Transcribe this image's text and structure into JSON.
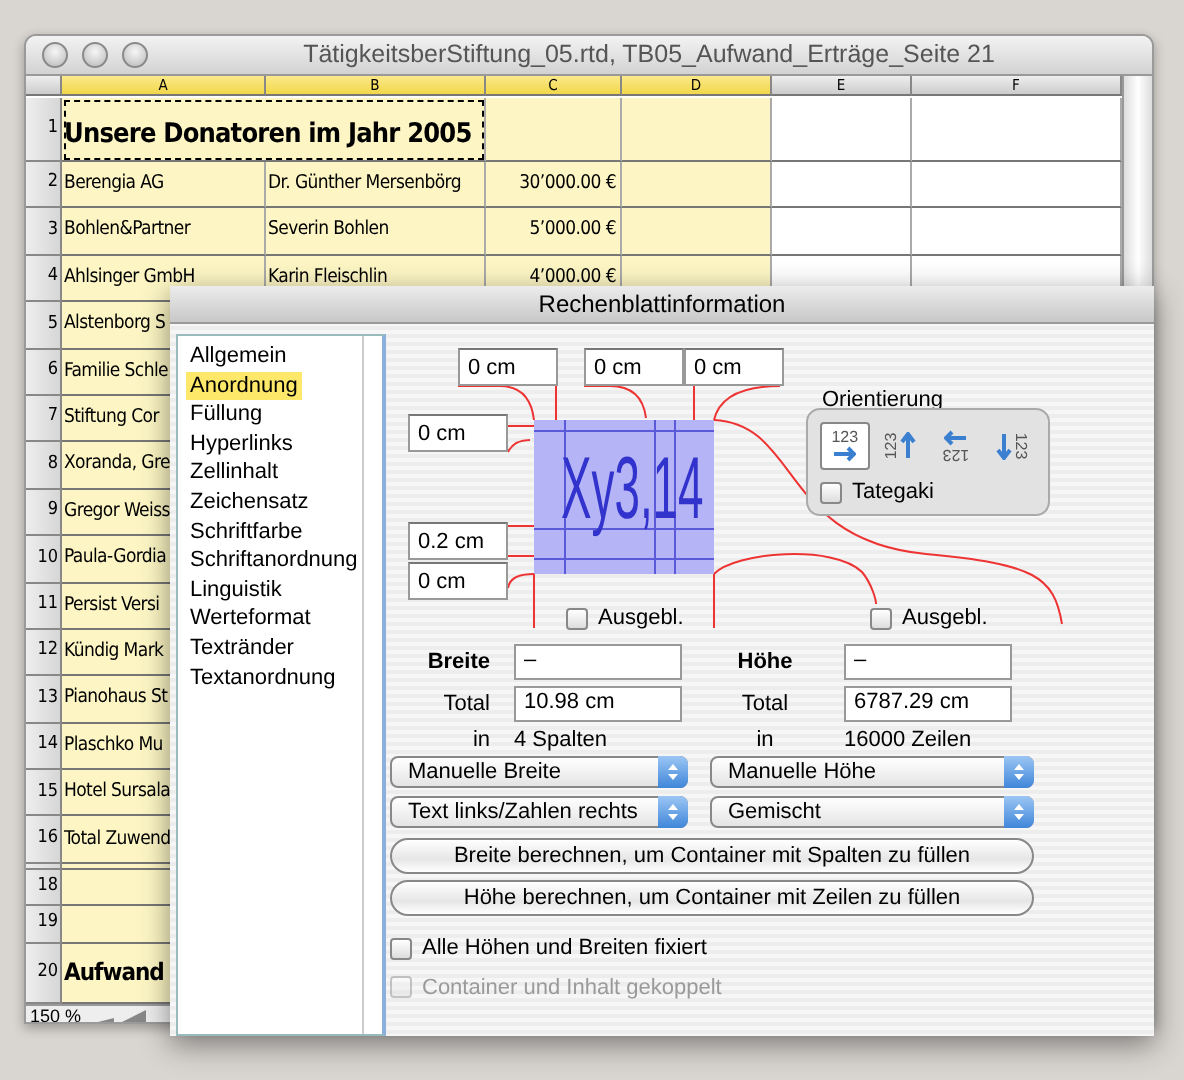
{
  "window": {
    "title": "TätigkeitsberStiftung_05.rtd, TB05_Aufwand_Erträge_Seite 21"
  },
  "spreadsheet": {
    "columns": [
      {
        "label": "A",
        "selected": true,
        "kind": "text"
      },
      {
        "label": "B",
        "selected": true,
        "kind": "text"
      },
      {
        "label": "C",
        "selected": true,
        "kind": "number"
      },
      {
        "label": "D",
        "selected": true,
        "kind": "text"
      },
      {
        "label": "E",
        "selected": false,
        "kind": "text"
      },
      {
        "label": "F",
        "selected": false,
        "kind": "text"
      }
    ],
    "rows": [
      {
        "number": "1",
        "kind": "title",
        "marked": true,
        "cells": [
          "Unsere Donatoren im Jahr 2005"
        ]
      },
      {
        "number": "2",
        "kind": "row",
        "cells": [
          "Berengia AG",
          "Dr. Günther Mersenbörg",
          "30’000.00 €"
        ]
      },
      {
        "number": "3",
        "kind": "row",
        "cells": [
          "Bohlen&Partner",
          "Severin Bohlen",
          "5’000.00 €"
        ]
      },
      {
        "number": "4",
        "kind": "row",
        "cells": [
          "Ahlsinger GmbH",
          "Karin Fleischlin",
          "4’000.00 €"
        ]
      },
      {
        "number": "5",
        "kind": "row",
        "cells": [
          "Alstenborg S"
        ]
      },
      {
        "number": "6",
        "kind": "row",
        "cells": [
          "Familie Schle"
        ]
      },
      {
        "number": "7",
        "kind": "row",
        "cells": [
          "Stiftung Cor"
        ]
      },
      {
        "number": "8",
        "kind": "row",
        "cells": [
          "Xoranda, Gre"
        ]
      },
      {
        "number": "9",
        "kind": "row",
        "cells": [
          "Gregor Weiss"
        ]
      },
      {
        "number": "10",
        "kind": "row",
        "cells": [
          "Paula-Gordia"
        ]
      },
      {
        "number": "11",
        "kind": "row",
        "cells": [
          "Persist Versi"
        ]
      },
      {
        "number": "12",
        "kind": "row",
        "cells": [
          "Kündig Mark"
        ]
      },
      {
        "number": "13",
        "kind": "row",
        "cells": [
          "Pianohaus St"
        ]
      },
      {
        "number": "14",
        "kind": "row",
        "cells": [
          "Plaschko Mu"
        ]
      },
      {
        "number": "15",
        "kind": "row",
        "cells": [
          "Hotel Sursala"
        ]
      },
      {
        "number": "16",
        "kind": "row",
        "cells": [
          "Total Zuwend"
        ]
      },
      {
        "kind": "collapsed",
        "cells": []
      },
      {
        "number": "18",
        "kind": "empty",
        "cells": []
      },
      {
        "number": "19",
        "kind": "empty",
        "cells": []
      },
      {
        "number": "20",
        "kind": "heading",
        "cells": [
          "Aufwand"
        ]
      }
    ],
    "zoom": "150 %"
  },
  "dialog": {
    "title": "Rechenblattinformation",
    "categories": [
      {
        "label": "Allgemein",
        "selected": false
      },
      {
        "label": "Anordnung",
        "selected": true
      },
      {
        "label": "Füllung",
        "selected": false
      },
      {
        "label": "Hyperlinks",
        "selected": false
      },
      {
        "label": "Zellinhalt",
        "selected": false
      },
      {
        "label": "Zeichensatz",
        "selected": false
      },
      {
        "label": "Schriftfarbe",
        "selected": false
      },
      {
        "label": "Schriftanordnung",
        "selected": false
      },
      {
        "label": "Linguistik",
        "selected": false
      },
      {
        "label": "Werteformat",
        "selected": false
      },
      {
        "label": "Textränder",
        "selected": false
      },
      {
        "label": "Textanordnung",
        "selected": false
      }
    ],
    "margins": {
      "top_left": "0 cm",
      "top_middle": "0 cm",
      "top_right": "0 cm",
      "left_top": "0 cm",
      "left_lower": "0.2 cm",
      "left_bottom": "0 cm"
    },
    "preview_sample": "Xy3,14",
    "orientation": {
      "label": "Orientierung",
      "options": [
        {
          "label": "123",
          "kind": "right",
          "selected": true
        },
        {
          "label": "123",
          "kind": "up",
          "selected": false
        },
        {
          "label": "123",
          "kind": "left",
          "selected": false
        },
        {
          "label": "123",
          "kind": "down",
          "selected": false
        }
      ],
      "tategaki": {
        "label": "Tategaki",
        "checked": false
      }
    },
    "width": {
      "hidden": {
        "label": "Ausgebl.",
        "checked": false
      },
      "label": "Breite",
      "value": "–",
      "total_label": "Total",
      "total": "10.98 cm",
      "in_label": "in",
      "count": "4 Spalten",
      "mode": "Manuelle Breite",
      "alignment": "Text links/Zahlen rechts"
    },
    "height": {
      "hidden": {
        "label": "Ausgebl.",
        "checked": false
      },
      "label": "Höhe",
      "value": "–",
      "total_label": "Total",
      "total": "6787.29 cm",
      "in_label": "in",
      "count": "16000 Zeilen",
      "mode": "Manuelle Höhe",
      "alignment": "Gemischt"
    },
    "buttons": [
      "Breite berechnen, um Container mit Spalten zu füllen",
      "Höhe berechnen, um Container mit Zeilen zu füllen"
    ],
    "options": [
      {
        "label": "Alle Höhen und Breiten fixiert",
        "checked": false,
        "disabled": false
      },
      {
        "label": "Container und Inhalt gekoppelt",
        "checked": false,
        "disabled": true
      }
    ]
  }
}
